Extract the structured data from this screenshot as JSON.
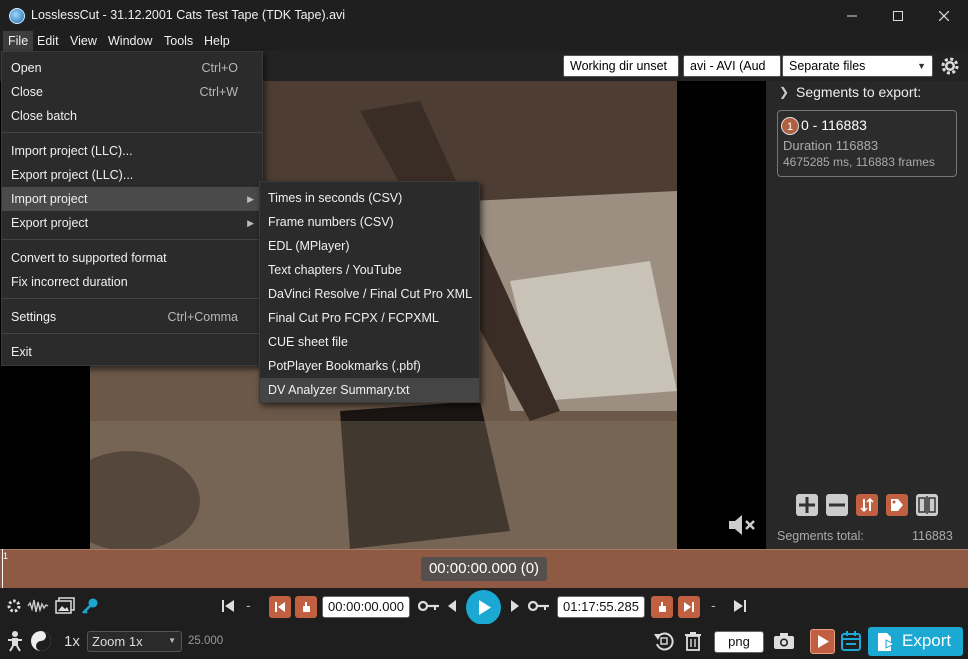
{
  "window": {
    "title": "LosslessCut - 31.12.2001 Cats Test Tape (TDK Tape).avi"
  },
  "menubar": [
    "File",
    "Edit",
    "View",
    "Window",
    "Tools",
    "Help"
  ],
  "toolbar": {
    "working_dir": "Working dir unset",
    "format": "avi - AVI (Aud",
    "output_mode": "Separate files"
  },
  "file_menu": {
    "items": [
      {
        "label": "Open",
        "shortcut": "Ctrl+O"
      },
      {
        "label": "Close",
        "shortcut": "Ctrl+W"
      },
      {
        "label": "Close batch",
        "shortcut": ""
      },
      {
        "label": "Import project (LLC)...",
        "shortcut": ""
      },
      {
        "label": "Export project (LLC)...",
        "shortcut": ""
      },
      {
        "label": "Import project",
        "shortcut": ""
      },
      {
        "label": "Export project",
        "shortcut": ""
      },
      {
        "label": "Convert to supported format",
        "shortcut": ""
      },
      {
        "label": "Fix incorrect duration",
        "shortcut": ""
      },
      {
        "label": "Settings",
        "shortcut": "Ctrl+Comma"
      },
      {
        "label": "Exit",
        "shortcut": ""
      }
    ]
  },
  "import_submenu": {
    "items": [
      "Times in seconds (CSV)",
      "Frame numbers (CSV)",
      "EDL (MPlayer)",
      "Text chapters / YouTube",
      "DaVinci Resolve / Final Cut Pro XML",
      "Final Cut Pro FCPX / FCPXML",
      "CUE sheet file",
      "PotPlayer Bookmarks (.pbf)",
      "DV Analyzer Summary.txt"
    ]
  },
  "segments_panel": {
    "header": "Segments to export:",
    "segment": {
      "index": "1",
      "range": "0 - 116883",
      "duration": "Duration 116883",
      "details": "4675285 ms, 116883 frames"
    },
    "total_label": "Segments total:",
    "total_value": "116883"
  },
  "timeline": {
    "current_time": "00:00:00.000 (0)",
    "marker": "1"
  },
  "controls": {
    "dash": "-",
    "start_time": "00:00:00.000",
    "end_time": "01:17:55.285",
    "speed": "1x",
    "zoom": "Zoom 1x",
    "fps": "25.000",
    "snapshot_format": "png",
    "export_label": "Export"
  },
  "colors": {
    "accent": "#1ba8d3",
    "timeline": "#8f5a43",
    "segment_orange": "#c06040",
    "export_bg": "#1ba8d3"
  }
}
